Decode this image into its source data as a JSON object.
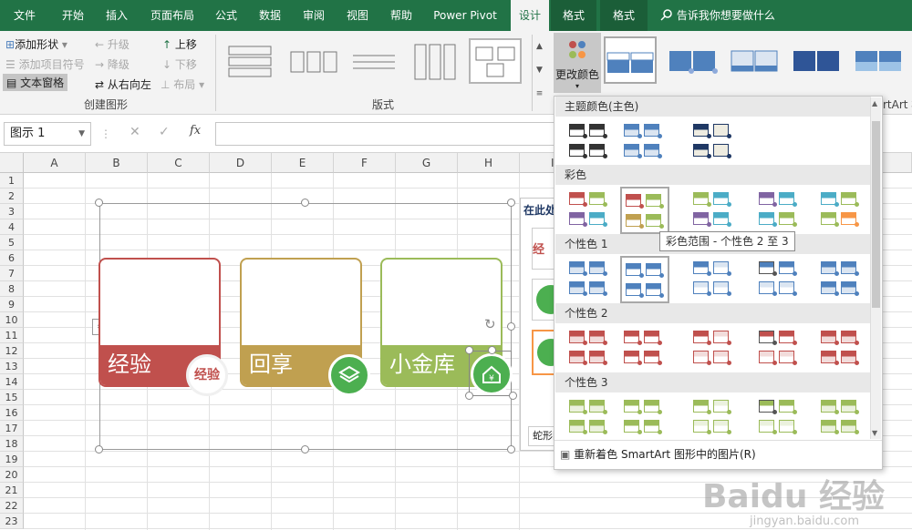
{
  "tabs": [
    "文件",
    "开始",
    "插入",
    "页面布局",
    "公式",
    "数据",
    "审阅",
    "视图",
    "帮助",
    "Power Pivot",
    "设计",
    "格式",
    "格式"
  ],
  "tell_me": "告诉我你想要做什么",
  "ribbon": {
    "add_shape": "添加形状",
    "add_bullet": "添加项目符号",
    "text_pane": "文本窗格",
    "promote": "升级",
    "demote": "降级",
    "rtl": "从右向左",
    "move_up": "上移",
    "move_down": "下移",
    "layout": "布局",
    "group_create": "创建图形",
    "group_layouts": "版式",
    "change_colors": "更改颜色",
    "partial_label": "rtArt 样"
  },
  "formula_bar": {
    "name_box": "图示 1",
    "fx": "fx"
  },
  "columns": [
    "A",
    "B",
    "C",
    "D",
    "E",
    "F",
    "G",
    "H",
    "I"
  ],
  "rows": [
    "1",
    "2",
    "3",
    "4",
    "5",
    "6",
    "7",
    "8",
    "9",
    "10",
    "11",
    "12",
    "13",
    "14",
    "15",
    "16",
    "17",
    "18",
    "19",
    "20",
    "21",
    "22",
    "23"
  ],
  "smartart": {
    "cards": [
      {
        "text": "经验",
        "color": "#c0504d"
      },
      {
        "text": "回享",
        "color": "#c0a050"
      },
      {
        "text": "小金库",
        "color": "#9bbb59"
      }
    ],
    "text_pane_title": "在此处",
    "text_pane_footer": "蛇形图",
    "circle_icons": [
      "jingyan-logo-icon",
      "layers-icon",
      "home-yen-icon"
    ]
  },
  "dropdown": {
    "sections": [
      "主题颜色(主色)",
      "彩色",
      "个性色 1",
      "个性色 2",
      "个性色 3"
    ],
    "tooltip": "彩色范围 - 个性色 2 至 3",
    "footer": "重新着色 SmartArt 图形中的图片(R)",
    "colorful_sets": [
      [
        "#c0504d",
        "#9bbb59",
        "#8064a2",
        "#4bacc6"
      ],
      [
        "#c0504d",
        "#9bbb59",
        "#c0a050",
        "#9bbb59"
      ],
      [
        "#9bbb59",
        "#4bacc6",
        "#8064a2",
        "#4bacc6"
      ],
      [
        "#8064a2",
        "#4bacc6",
        "#4bacc6",
        "#9bbb59"
      ],
      [
        "#4bacc6",
        "#9bbb59",
        "#9bbb59",
        "#f79646"
      ]
    ]
  },
  "colors": {
    "excel_green": "#217346",
    "accent1": "#4f81bd",
    "accent2": "#c0504d",
    "accent3": "#9bbb59"
  },
  "watermark": {
    "brand": "Baidu 经验",
    "url": "jingyan.baidu.com"
  }
}
